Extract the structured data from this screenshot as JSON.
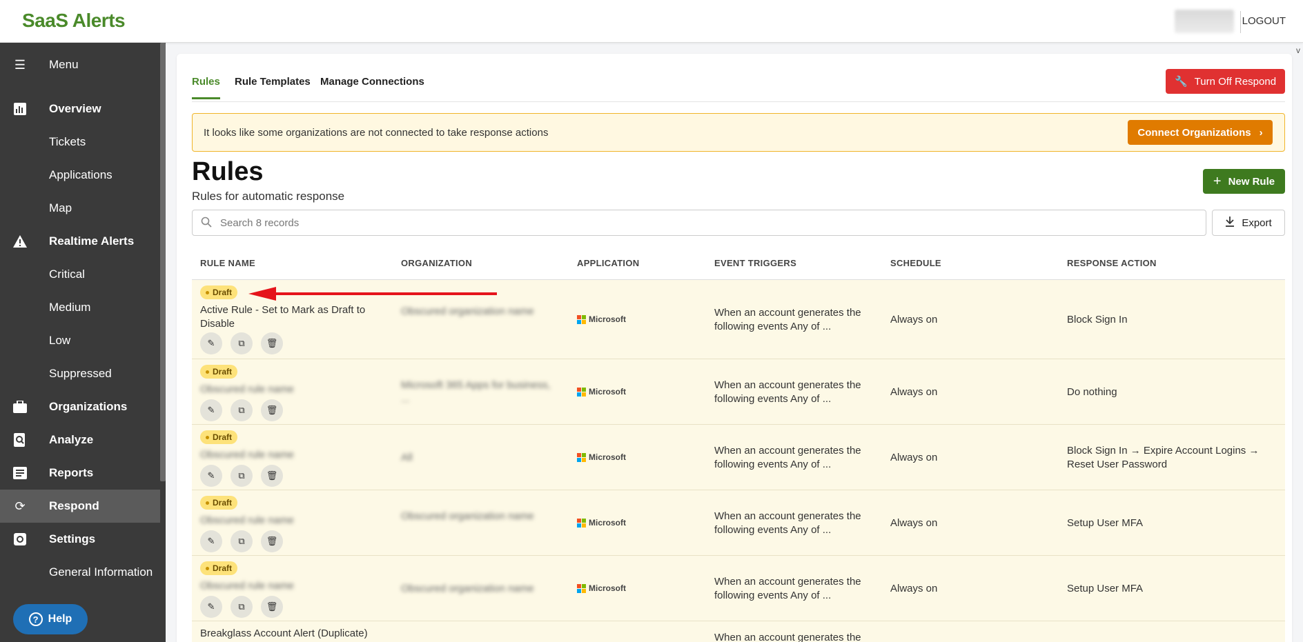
{
  "header": {
    "logo_text": "SaaS Alerts",
    "logout_label": "LOGOUT"
  },
  "sidebar": {
    "menu_label": "Menu",
    "items": [
      {
        "label": "Overview",
        "icon": "chart-icon",
        "main": true
      },
      {
        "label": "Tickets"
      },
      {
        "label": "Applications"
      },
      {
        "label": "Map"
      },
      {
        "label": "Realtime Alerts",
        "icon": "warning-icon",
        "main": true
      },
      {
        "label": "Critical"
      },
      {
        "label": "Medium"
      },
      {
        "label": "Low"
      },
      {
        "label": "Suppressed"
      },
      {
        "label": "Organizations",
        "icon": "briefcase-icon",
        "main": true
      },
      {
        "label": "Analyze",
        "icon": "search-doc-icon",
        "main": true
      },
      {
        "label": "Reports",
        "icon": "report-icon",
        "main": true
      },
      {
        "label": "Respond",
        "icon": "refresh-icon",
        "main": true,
        "active": true
      },
      {
        "label": "Settings",
        "icon": "gear-icon",
        "main": true
      },
      {
        "label": "General Information"
      }
    ],
    "help_label": "Help"
  },
  "tabs": [
    {
      "label": "Rules",
      "active": true
    },
    {
      "label": "Rule Templates"
    },
    {
      "label": "Manage Connections"
    }
  ],
  "turn_off_label": "Turn Off Respond",
  "banner": {
    "text": "It looks like some organizations are not connected to take response actions",
    "button_label": "Connect Organizations"
  },
  "page": {
    "title": "Rules",
    "subtitle": "Rules for automatic response",
    "new_rule_label": "New Rule",
    "export_label": "Export",
    "v_mark": "v"
  },
  "search": {
    "placeholder": "Search 8 records"
  },
  "table": {
    "headers": [
      "RULE NAME",
      "ORGANIZATION",
      "APPLICATION",
      "EVENT TRIGGERS",
      "SCHEDULE",
      "RESPONSE ACTION"
    ],
    "rows": [
      {
        "badge": "Draft",
        "rule_name": "Active Rule - Set to Mark as Draft to Disable",
        "organization": "Obscured organization name",
        "application": "Microsoft",
        "event_triggers": "When an account generates the following events Any of ...",
        "schedule": "Always on",
        "response_action": "Block Sign In"
      },
      {
        "badge": "Draft",
        "rule_name": "Obscured rule name",
        "organization": "Microsoft 365 Apps for business, ...",
        "application": "Microsoft",
        "event_triggers": "When an account generates the following events Any of ...",
        "schedule": "Always on",
        "response_action": "Do nothing"
      },
      {
        "badge": "Draft",
        "rule_name": "Obscured rule name",
        "organization": "All",
        "application": "Microsoft",
        "event_triggers": "When an account generates the following events Any of ...",
        "schedule": "Always on",
        "response_action": "Block Sign In → Expire Account Logins → Reset User Password"
      },
      {
        "badge": "Draft",
        "rule_name": "Obscured rule name",
        "organization": "Obscured organization name",
        "application": "Microsoft",
        "event_triggers": "When an account generates the following events Any of ...",
        "schedule": "Always on",
        "response_action": "Setup User MFA"
      },
      {
        "badge": "Draft",
        "rule_name": "Obscured rule name",
        "organization": "Obscured organization name",
        "application": "Microsoft",
        "event_triggers": "When an account generates the following events Any of ...",
        "schedule": "Always on",
        "response_action": "Setup User MFA"
      },
      {
        "badge": "",
        "rule_name": "Breakglass Account Alert (Duplicate)",
        "organization": "",
        "application": "",
        "event_triggers": "When an account generates the",
        "schedule": "",
        "response_action": ""
      }
    ]
  },
  "colors": {
    "brand_green": "#4a8a2a",
    "danger_red": "#e03131",
    "warning_orange": "#e07b00",
    "sidebar_bg": "#3a3a3a",
    "draft_badge": "#fde27a",
    "row_highlight": "#fdf9e6"
  }
}
